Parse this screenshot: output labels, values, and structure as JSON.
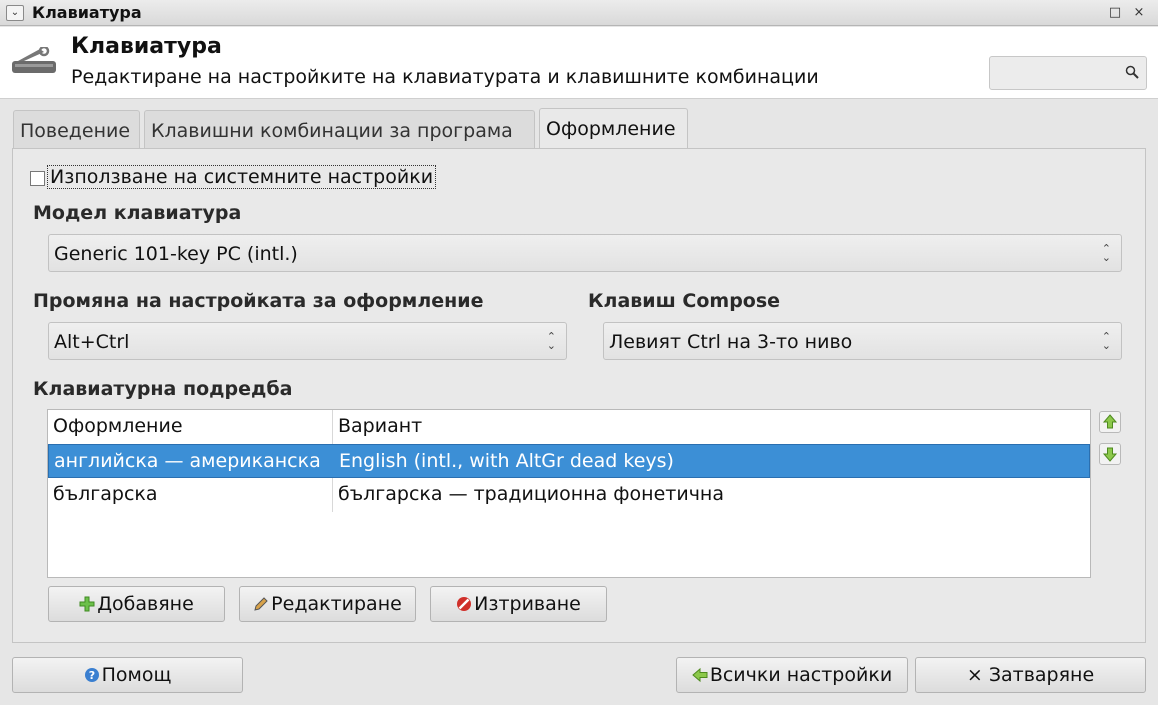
{
  "window": {
    "title": "Клавиатура",
    "menu_glyph": "⌄",
    "maximize_glyph": "□",
    "close_glyph": "×"
  },
  "header": {
    "title": "Клавиатура",
    "subtitle": "Редактиране на настройките на клавиатурата и клавишните комбинации",
    "icon": "keyboard-tools-icon",
    "search": {
      "placeholder": "",
      "icon": "search-icon"
    }
  },
  "tabs": [
    {
      "label": "Поведение",
      "active": false
    },
    {
      "label": "Клавишни комбинации за програма",
      "active": false
    },
    {
      "label": "Оформление",
      "active": true
    }
  ],
  "layout_tab": {
    "use_system_settings": {
      "label": "Използване на системните настройки",
      "checked": false
    },
    "keyboard_model": {
      "label": "Модел клавиатура",
      "value": "Generic 101-key PC (intl.)"
    },
    "change_layout": {
      "label": "Промяна на настройката за оформление",
      "value": "Alt+Ctrl"
    },
    "compose_key": {
      "label": "Клавиш Compose",
      "value": "Левият Ctrl на 3-то ниво"
    },
    "layouts_section": {
      "label": "Клавиатурна подредба",
      "columns": [
        "Оформление",
        "Вариант"
      ],
      "rows": [
        {
          "layout": "английска — американска",
          "variant": "English (intl., with AltGr dead keys)",
          "selected": true
        },
        {
          "layout": "българска",
          "variant": "българска — традиционна фонетична",
          "selected": false
        }
      ],
      "move_up_icon": "arrow-up-icon",
      "move_down_icon": "arrow-down-icon"
    },
    "buttons": {
      "add": "Добавяне",
      "edit": "Редактиране",
      "delete": "Изтриване"
    }
  },
  "footer": {
    "help": "Помощ",
    "all_settings": "Всички настройки",
    "close": "Затваряне",
    "close_glyph": "×"
  },
  "colors": {
    "selection": "#3c8fd6",
    "add_icon": "#5fb43c",
    "delete_icon": "#d0302a",
    "help_icon": "#3a7fd0"
  }
}
